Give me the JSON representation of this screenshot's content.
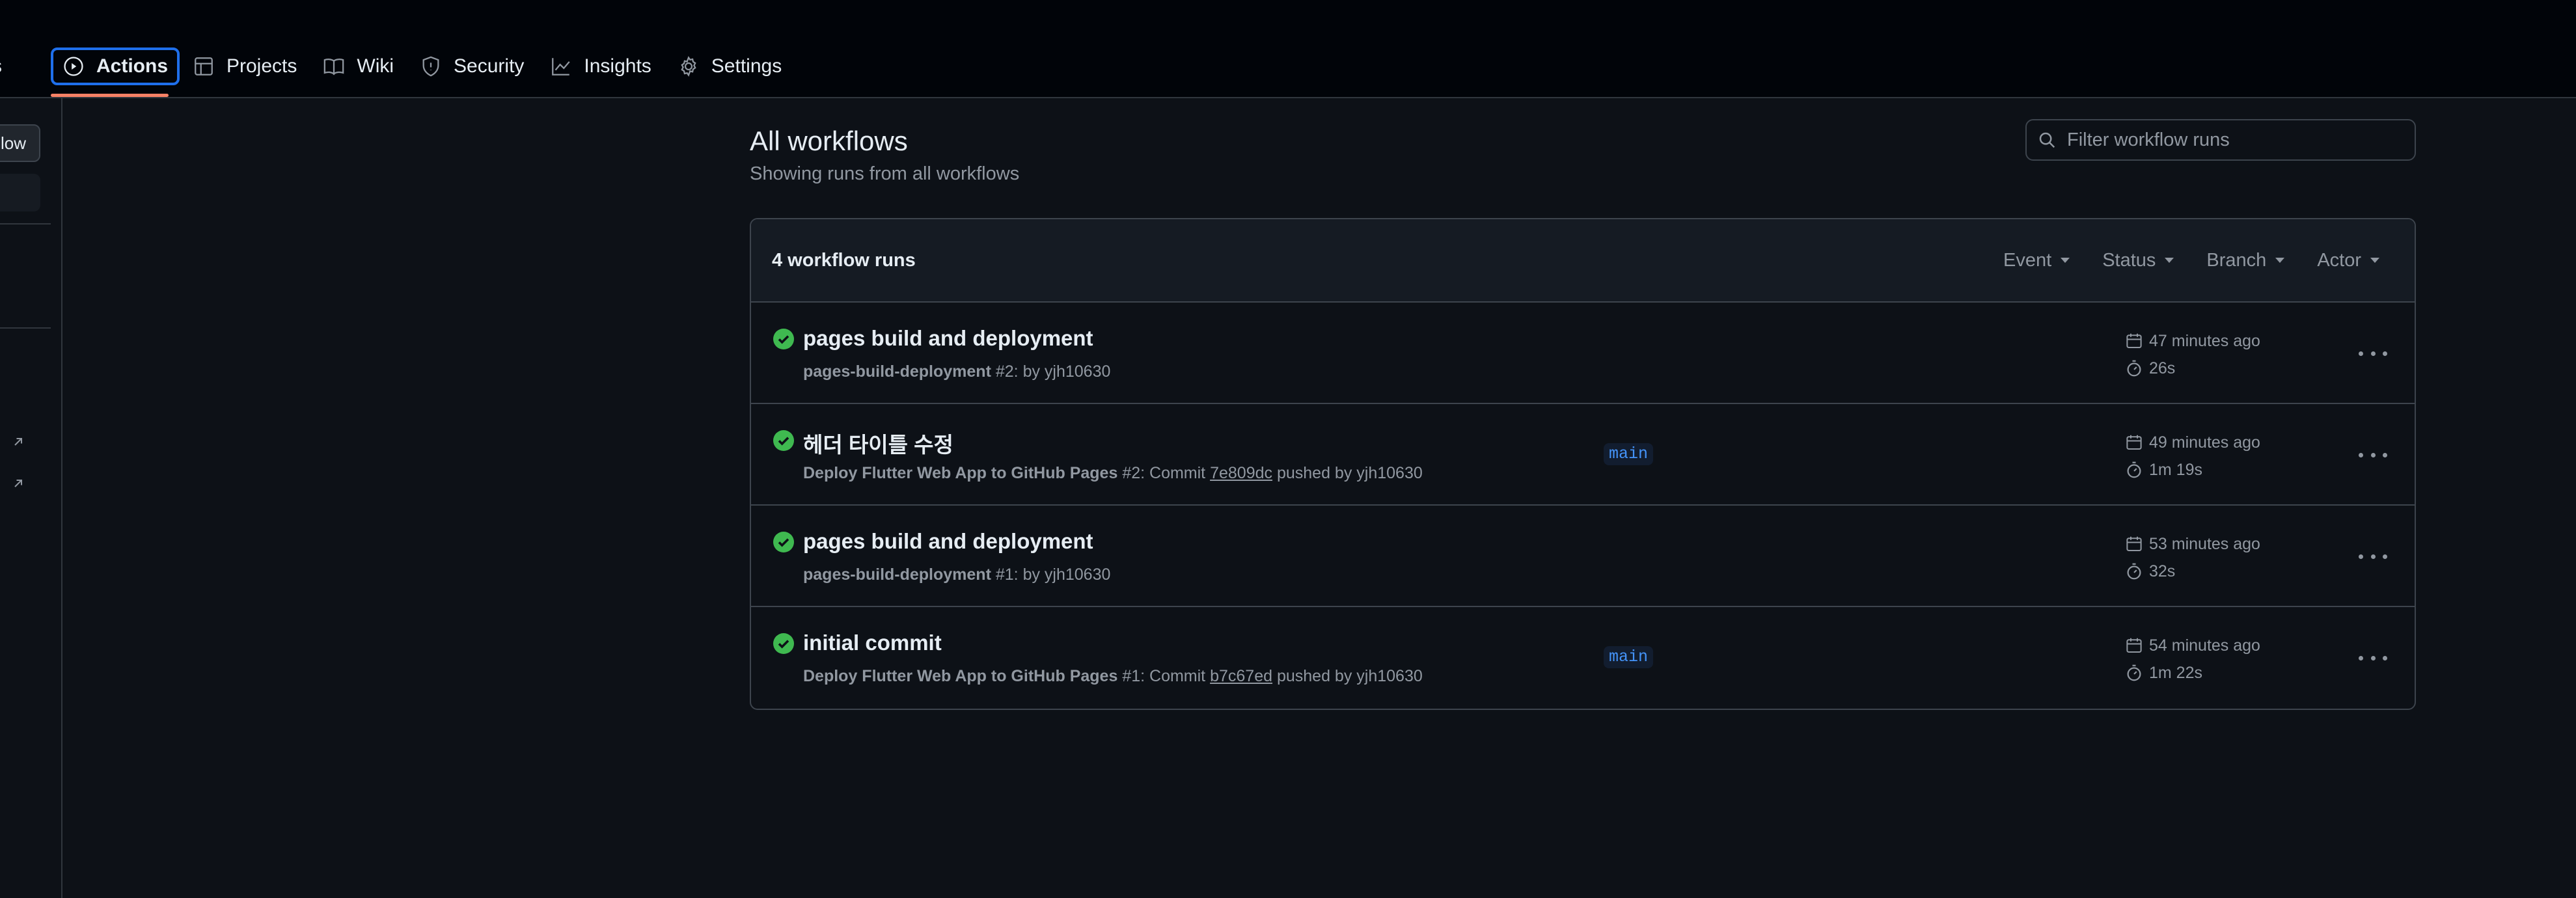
{
  "nav": {
    "pull_requests_clipped": "ests",
    "actions": "Actions",
    "projects": "Projects",
    "wiki": "Wiki",
    "security": "Security",
    "insights": "Insights",
    "settings": "Settings"
  },
  "sidebar": {
    "new_workflow_clipped": "low"
  },
  "main": {
    "title": "All workflows",
    "subtitle": "Showing runs from all workflows",
    "filter_placeholder": "Filter workflow runs"
  },
  "runs": {
    "count_label": "4 workflow runs",
    "filters": [
      "Event",
      "Status",
      "Branch",
      "Actor"
    ],
    "items": [
      {
        "title": "pages build and deployment",
        "workflow": "pages-build-deployment",
        "run_number": "#2",
        "meta_rest": ": by yjh10630",
        "branch": "",
        "time": "47 minutes ago",
        "duration": "26s"
      },
      {
        "title": "헤더 타이틀 수정",
        "workflow": "Deploy Flutter Web App to GitHub Pages",
        "run_number": "#2",
        "commit_prefix": ": Commit ",
        "sha": "7e809dc",
        "meta_rest": " pushed by yjh10630",
        "branch": "main",
        "time": "49 minutes ago",
        "duration": "1m 19s"
      },
      {
        "title": "pages build and deployment",
        "workflow": "pages-build-deployment",
        "run_number": "#1",
        "meta_rest": ": by yjh10630",
        "branch": "",
        "time": "53 minutes ago",
        "duration": "32s"
      },
      {
        "title": "initial commit",
        "workflow": "Deploy Flutter Web App to GitHub Pages",
        "run_number": "#1",
        "commit_prefix": ": Commit ",
        "sha": "b7c67ed",
        "meta_rest": " pushed by yjh10630",
        "branch": "main",
        "time": "54 minutes ago",
        "duration": "1m 22s"
      }
    ]
  },
  "colors": {
    "background": "#0d1117",
    "success": "#3fb950",
    "accent": "#1f6feb",
    "underline": "#f78166"
  }
}
